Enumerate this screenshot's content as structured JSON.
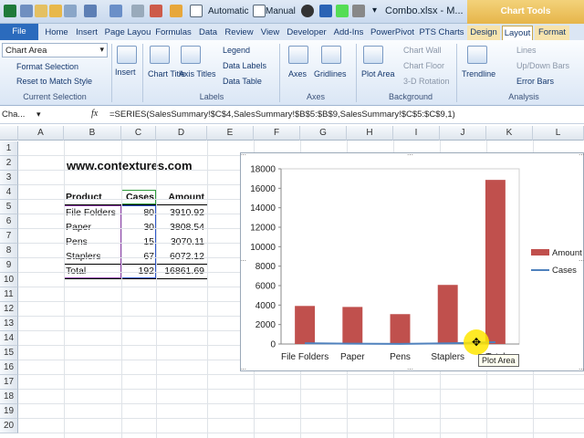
{
  "window": {
    "title": "Combo.xlsx - M...",
    "automatic_label": "Automatic",
    "manual_label": "Manual",
    "context_tab": "Chart Tools"
  },
  "tabs": [
    "File",
    "Home",
    "Insert",
    "Page Layou",
    "Formulas",
    "Data",
    "Review",
    "View",
    "Developer",
    "Add-Ins",
    "PowerPivot",
    "PTS Charts",
    "Design",
    "Layout",
    "Format"
  ],
  "ribbon": {
    "chart_element": "Chart Area",
    "format_selection": "Format Selection",
    "reset_style": "Reset to Match Style",
    "group_current": "Current Selection",
    "insert": "Insert",
    "chart_title": "Chart Title",
    "axis_titles": "Axis Titles",
    "legend": "Legend",
    "data_labels": "Data Labels",
    "data_table": "Data Table",
    "group_labels": "Labels",
    "axes": "Axes",
    "gridlines": "Gridlines",
    "group_axes": "Axes",
    "plot_area": "Plot Area",
    "chart_wall": "Chart Wall",
    "chart_floor": "Chart Floor",
    "rotation": "3-D Rotation",
    "group_background": "Background",
    "trendline": "Trendline",
    "lines": "Lines",
    "updown_bars": "Up/Down Bars",
    "error_bars": "Error Bars",
    "group_analysis": "Analysis"
  },
  "formula_bar": {
    "name_box": "Cha...",
    "fx": "fx",
    "formula": "=SERIES(SalesSummary!$C$4,SalesSummary!$B$5:$B$9,SalesSummary!$C$5:$C$9,1)"
  },
  "columns": [
    "A",
    "B",
    "C",
    "D",
    "E",
    "F",
    "G",
    "H",
    "I",
    "J",
    "K",
    "L"
  ],
  "rows": [
    "1",
    "2",
    "3",
    "4",
    "5",
    "6",
    "7",
    "8",
    "9",
    "10",
    "11",
    "12",
    "13",
    "14",
    "15",
    "16",
    "17",
    "18",
    "19",
    "20"
  ],
  "sheet": {
    "heading": "www.contextures.com",
    "headers": [
      "Product",
      "Cases",
      "Amount"
    ],
    "data": [
      [
        "File Folders",
        "80",
        "3910.92"
      ],
      [
        "Paper",
        "30",
        "3808.54"
      ],
      [
        "Pens",
        "15",
        "3070.11"
      ],
      [
        "Staplers",
        "67",
        "6072.12"
      ],
      [
        "Total",
        "192",
        "16861.69"
      ]
    ]
  },
  "chart_data": {
    "type": "bar",
    "categories": [
      "File Folders",
      "Paper",
      "Pens",
      "Staplers",
      "Total"
    ],
    "series": [
      {
        "name": "Amount",
        "type": "bar",
        "values": [
          3910.92,
          3808.54,
          3070.11,
          6072.12,
          16861.69
        ],
        "color": "#c0504d"
      },
      {
        "name": "Cases",
        "type": "line",
        "values": [
          80,
          30,
          15,
          67,
          192
        ],
        "color": "#4f81bd"
      }
    ],
    "y_ticks": [
      "18000",
      "16000",
      "14000",
      "12000",
      "10000",
      "8000",
      "6000",
      "4000",
      "2000",
      "0"
    ],
    "ylim": [
      0,
      18000
    ],
    "legend": "right"
  },
  "tooltip": "Plot Area"
}
